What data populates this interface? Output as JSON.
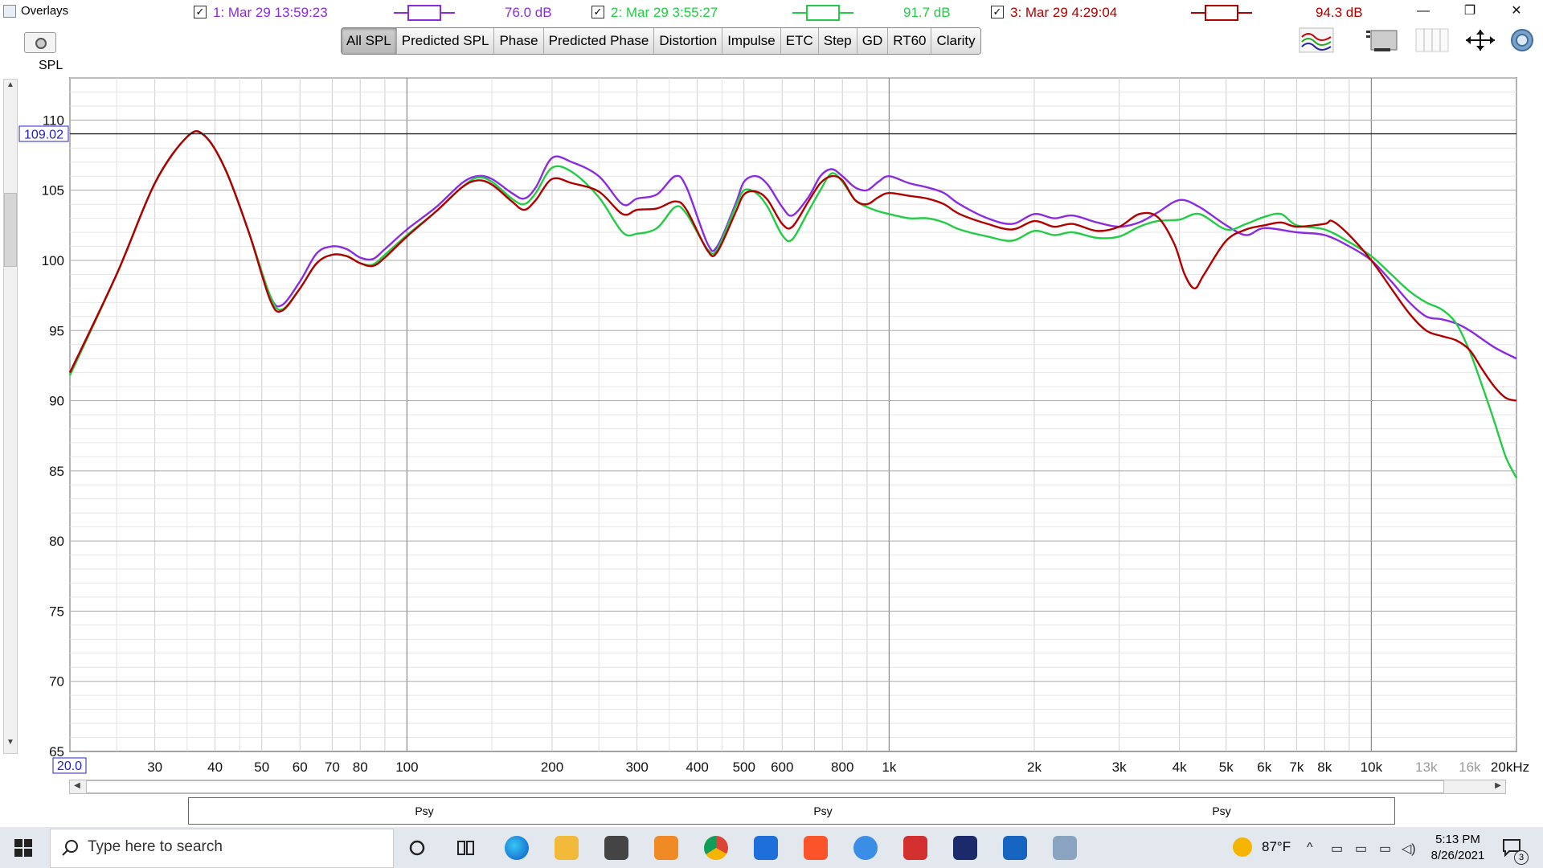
{
  "window": {
    "title": "Overlays",
    "controls": [
      "—",
      "❐",
      "✕"
    ]
  },
  "toolbar": {
    "y_axis_label": "SPL",
    "tabs": [
      "All SPL",
      "Predicted SPL",
      "Phase",
      "Predicted Phase",
      "Distortion",
      "Impulse",
      "ETC",
      "Step",
      "GD",
      "RT60",
      "Clarity"
    ],
    "active_tab": "All SPL",
    "icons": [
      "camera-icon",
      "overlay-traces-icon",
      "graph-panel-icon",
      "columns-icon",
      "fit-arrows-icon",
      "settings-gear-icon"
    ]
  },
  "chart_data": {
    "type": "line",
    "ylabel": "SPL",
    "xscale": "log",
    "xlim": [
      20,
      20000
    ],
    "ylim": [
      65,
      113
    ],
    "grid": true,
    "cursor_value_label": "109.02",
    "x_start_label": "20.0",
    "cursor_y": 109.02,
    "y_ticks": [
      65,
      70,
      75,
      80,
      85,
      90,
      95,
      100,
      105,
      110
    ],
    "x_ticks": [
      {
        "v": 30,
        "t": "30"
      },
      {
        "v": 40,
        "t": "40"
      },
      {
        "v": 50,
        "t": "50"
      },
      {
        "v": 60,
        "t": "60"
      },
      {
        "v": 70,
        "t": "70"
      },
      {
        "v": 80,
        "t": "80"
      },
      {
        "v": 100,
        "t": "100"
      },
      {
        "v": 200,
        "t": "200"
      },
      {
        "v": 300,
        "t": "300"
      },
      {
        "v": 400,
        "t": "400"
      },
      {
        "v": 500,
        "t": "500"
      },
      {
        "v": 600,
        "t": "600"
      },
      {
        "v": 800,
        "t": "800"
      },
      {
        "v": 1000,
        "t": "1k"
      },
      {
        "v": 2000,
        "t": "2k"
      },
      {
        "v": 3000,
        "t": "3k"
      },
      {
        "v": 4000,
        "t": "4k"
      },
      {
        "v": 5000,
        "t": "5k"
      },
      {
        "v": 6000,
        "t": "6k"
      },
      {
        "v": 7000,
        "t": "7k"
      },
      {
        "v": 8000,
        "t": "8k"
      },
      {
        "v": 10000,
        "t": "10k"
      },
      {
        "v": 13000,
        "t": "13k"
      },
      {
        "v": 16000,
        "t": "16k"
      },
      {
        "v": 20000,
        "t": "20kHz"
      }
    ],
    "series": [
      {
        "name": "1: Mar 29 13:59:23",
        "color": "#8a2be2",
        "value_label": "76.0 dB",
        "smoothing": "Psy",
        "points": [
          [
            20,
            92
          ],
          [
            25,
            99
          ],
          [
            30,
            105.5
          ],
          [
            35,
            108.8
          ],
          [
            38,
            108.9
          ],
          [
            42,
            106.5
          ],
          [
            47,
            102
          ],
          [
            52,
            97.5
          ],
          [
            55,
            96.8
          ],
          [
            60,
            98.5
          ],
          [
            65,
            100.5
          ],
          [
            70,
            101
          ],
          [
            75,
            100.8
          ],
          [
            80,
            100.2
          ],
          [
            85,
            100.1
          ],
          [
            90,
            100.8
          ],
          [
            100,
            102.2
          ],
          [
            115,
            103.8
          ],
          [
            130,
            105.5
          ],
          [
            140,
            106
          ],
          [
            150,
            105.8
          ],
          [
            165,
            104.8
          ],
          [
            175,
            104.4
          ],
          [
            185,
            105.2
          ],
          [
            200,
            107.3
          ],
          [
            220,
            107
          ],
          [
            250,
            106
          ],
          [
            280,
            104
          ],
          [
            300,
            104.4
          ],
          [
            330,
            104.7
          ],
          [
            360,
            106
          ],
          [
            380,
            105.2
          ],
          [
            420,
            101.2
          ],
          [
            440,
            101
          ],
          [
            480,
            104
          ],
          [
            500,
            105.6
          ],
          [
            530,
            106
          ],
          [
            560,
            105.4
          ],
          [
            600,
            103.8
          ],
          [
            630,
            103.2
          ],
          [
            680,
            104.5
          ],
          [
            720,
            106
          ],
          [
            760,
            106.5
          ],
          [
            800,
            106
          ],
          [
            850,
            105.2
          ],
          [
            900,
            105
          ],
          [
            950,
            105.6
          ],
          [
            1000,
            106
          ],
          [
            1100,
            105.5
          ],
          [
            1200,
            105.2
          ],
          [
            1300,
            104.8
          ],
          [
            1400,
            104
          ],
          [
            1600,
            103
          ],
          [
            1800,
            102.6
          ],
          [
            2000,
            103.3
          ],
          [
            2200,
            103
          ],
          [
            2400,
            103.2
          ],
          [
            2700,
            102.7
          ],
          [
            3000,
            102.4
          ],
          [
            3300,
            102.7
          ],
          [
            3600,
            103.4
          ],
          [
            4000,
            104.3
          ],
          [
            4400,
            103.8
          ],
          [
            5000,
            102.5
          ],
          [
            5500,
            101.8
          ],
          [
            6000,
            102.3
          ],
          [
            7000,
            102
          ],
          [
            8000,
            101.8
          ],
          [
            9000,
            101
          ],
          [
            10000,
            100
          ],
          [
            11000,
            98.5
          ],
          [
            12000,
            97
          ],
          [
            13000,
            96
          ],
          [
            14000,
            95.8
          ],
          [
            15000,
            95.5
          ],
          [
            16000,
            95
          ],
          [
            18000,
            93.8
          ],
          [
            20000,
            93
          ]
        ]
      },
      {
        "name": "2: Mar 29 3:55:27",
        "color": "#22cc44",
        "value_label": "91.7 dB",
        "smoothing": "Psy",
        "points": [
          [
            20,
            91.8
          ],
          [
            25,
            99
          ],
          [
            30,
            105.5
          ],
          [
            35,
            108.8
          ],
          [
            38,
            108.9
          ],
          [
            42,
            106.5
          ],
          [
            47,
            102
          ],
          [
            52,
            97.5
          ],
          [
            55,
            96.5
          ],
          [
            60,
            98
          ],
          [
            65,
            99.8
          ],
          [
            70,
            100.4
          ],
          [
            75,
            100.3
          ],
          [
            80,
            99.8
          ],
          [
            85,
            99.7
          ],
          [
            90,
            100.4
          ],
          [
            100,
            101.8
          ],
          [
            115,
            103.5
          ],
          [
            130,
            105.2
          ],
          [
            140,
            105.9
          ],
          [
            150,
            105.6
          ],
          [
            165,
            104.4
          ],
          [
            175,
            104
          ],
          [
            185,
            104.8
          ],
          [
            200,
            106.6
          ],
          [
            220,
            106.3
          ],
          [
            250,
            104.5
          ],
          [
            280,
            102
          ],
          [
            300,
            101.9
          ],
          [
            330,
            102.3
          ],
          [
            360,
            103.8
          ],
          [
            380,
            103.3
          ],
          [
            420,
            100.8
          ],
          [
            440,
            100.8
          ],
          [
            480,
            103.8
          ],
          [
            500,
            105
          ],
          [
            530,
            104.8
          ],
          [
            560,
            103.8
          ],
          [
            600,
            101.8
          ],
          [
            630,
            101.5
          ],
          [
            680,
            103.5
          ],
          [
            720,
            105
          ],
          [
            760,
            106.2
          ],
          [
            800,
            105.6
          ],
          [
            850,
            104.3
          ],
          [
            900,
            103.8
          ],
          [
            950,
            103.5
          ],
          [
            1000,
            103.3
          ],
          [
            1100,
            103
          ],
          [
            1200,
            103
          ],
          [
            1300,
            102.7
          ],
          [
            1400,
            102.2
          ],
          [
            1600,
            101.7
          ],
          [
            1800,
            101.4
          ],
          [
            2000,
            102.1
          ],
          [
            2200,
            101.8
          ],
          [
            2400,
            102
          ],
          [
            2700,
            101.6
          ],
          [
            3000,
            101.7
          ],
          [
            3300,
            102.4
          ],
          [
            3600,
            102.8
          ],
          [
            4000,
            102.9
          ],
          [
            4400,
            103.3
          ],
          [
            5000,
            102.2
          ],
          [
            5500,
            102.6
          ],
          [
            6000,
            103.1
          ],
          [
            6500,
            103.3
          ],
          [
            7000,
            102.5
          ],
          [
            8000,
            102.2
          ],
          [
            9000,
            101.3
          ],
          [
            10000,
            100.3
          ],
          [
            11000,
            99
          ],
          [
            12000,
            97.8
          ],
          [
            13000,
            97
          ],
          [
            14000,
            96.5
          ],
          [
            15000,
            95.5
          ],
          [
            16000,
            93.5
          ],
          [
            17000,
            91
          ],
          [
            18000,
            88.5
          ],
          [
            19000,
            86
          ],
          [
            20000,
            84.5
          ]
        ]
      },
      {
        "name": "3: Mar 29 4:29:04",
        "color": "#b00000",
        "value_label": "94.3 dB",
        "smoothing": "Psy",
        "points": [
          [
            20,
            92
          ],
          [
            25,
            99
          ],
          [
            30,
            105.5
          ],
          [
            35,
            108.8
          ],
          [
            38,
            108.9
          ],
          [
            42,
            106.5
          ],
          [
            47,
            102
          ],
          [
            52,
            97.2
          ],
          [
            55,
            96.4
          ],
          [
            60,
            98
          ],
          [
            65,
            99.8
          ],
          [
            70,
            100.4
          ],
          [
            75,
            100.3
          ],
          [
            80,
            99.8
          ],
          [
            85,
            99.6
          ],
          [
            90,
            100.2
          ],
          [
            100,
            101.7
          ],
          [
            115,
            103.5
          ],
          [
            130,
            105.2
          ],
          [
            140,
            105.7
          ],
          [
            150,
            105.4
          ],
          [
            165,
            104.2
          ],
          [
            175,
            103.6
          ],
          [
            185,
            104.3
          ],
          [
            200,
            105.8
          ],
          [
            220,
            105.5
          ],
          [
            250,
            104.9
          ],
          [
            280,
            103.3
          ],
          [
            300,
            103.6
          ],
          [
            330,
            103.7
          ],
          [
            360,
            104.2
          ],
          [
            380,
            103.6
          ],
          [
            420,
            100.7
          ],
          [
            440,
            100.6
          ],
          [
            480,
            103.4
          ],
          [
            500,
            104.7
          ],
          [
            530,
            104.9
          ],
          [
            560,
            104.3
          ],
          [
            600,
            102.6
          ],
          [
            630,
            102.4
          ],
          [
            680,
            104.2
          ],
          [
            720,
            105.5
          ],
          [
            760,
            106
          ],
          [
            800,
            105.7
          ],
          [
            850,
            104.3
          ],
          [
            900,
            104
          ],
          [
            950,
            104.5
          ],
          [
            1000,
            104.8
          ],
          [
            1100,
            104.6
          ],
          [
            1200,
            104.4
          ],
          [
            1300,
            104
          ],
          [
            1400,
            103.3
          ],
          [
            1600,
            102.6
          ],
          [
            1800,
            102.2
          ],
          [
            2000,
            102.8
          ],
          [
            2200,
            102.4
          ],
          [
            2400,
            102.6
          ],
          [
            2700,
            102.1
          ],
          [
            3000,
            102.4
          ],
          [
            3300,
            103.3
          ],
          [
            3600,
            103.1
          ],
          [
            3900,
            101.2
          ],
          [
            4100,
            99
          ],
          [
            4300,
            98
          ],
          [
            4500,
            99
          ],
          [
            5000,
            101.4
          ],
          [
            5500,
            102.2
          ],
          [
            6000,
            102.5
          ],
          [
            6500,
            102.7
          ],
          [
            7000,
            102.4
          ],
          [
            8000,
            102.6
          ],
          [
            8300,
            102.8
          ],
          [
            9000,
            101.8
          ],
          [
            10000,
            100
          ],
          [
            11000,
            98
          ],
          [
            12000,
            96.2
          ],
          [
            13000,
            95
          ],
          [
            14000,
            94.6
          ],
          [
            15000,
            94.3
          ],
          [
            16000,
            93.6
          ],
          [
            17000,
            92.2
          ],
          [
            18000,
            91
          ],
          [
            19000,
            90.2
          ],
          [
            20000,
            90
          ]
        ]
      }
    ]
  },
  "legend": {
    "items": [
      {
        "label": "1: Mar 29 13:59:23",
        "psy": "Psy",
        "value": "76.0 dB",
        "checked": "✓"
      },
      {
        "label": "2: Mar 29 3:55:27",
        "psy": "Psy",
        "value": "91.7 dB",
        "checked": "✓"
      },
      {
        "label": "3: Mar 29 4:29:04",
        "psy": "Psy",
        "value": "94.3 dB",
        "checked": "✓"
      }
    ]
  },
  "taskbar": {
    "search_placeholder": "Type here to search",
    "temperature": "87°F",
    "time": "5:13 PM",
    "date": "8/26/2021",
    "notification_count": "3"
  }
}
